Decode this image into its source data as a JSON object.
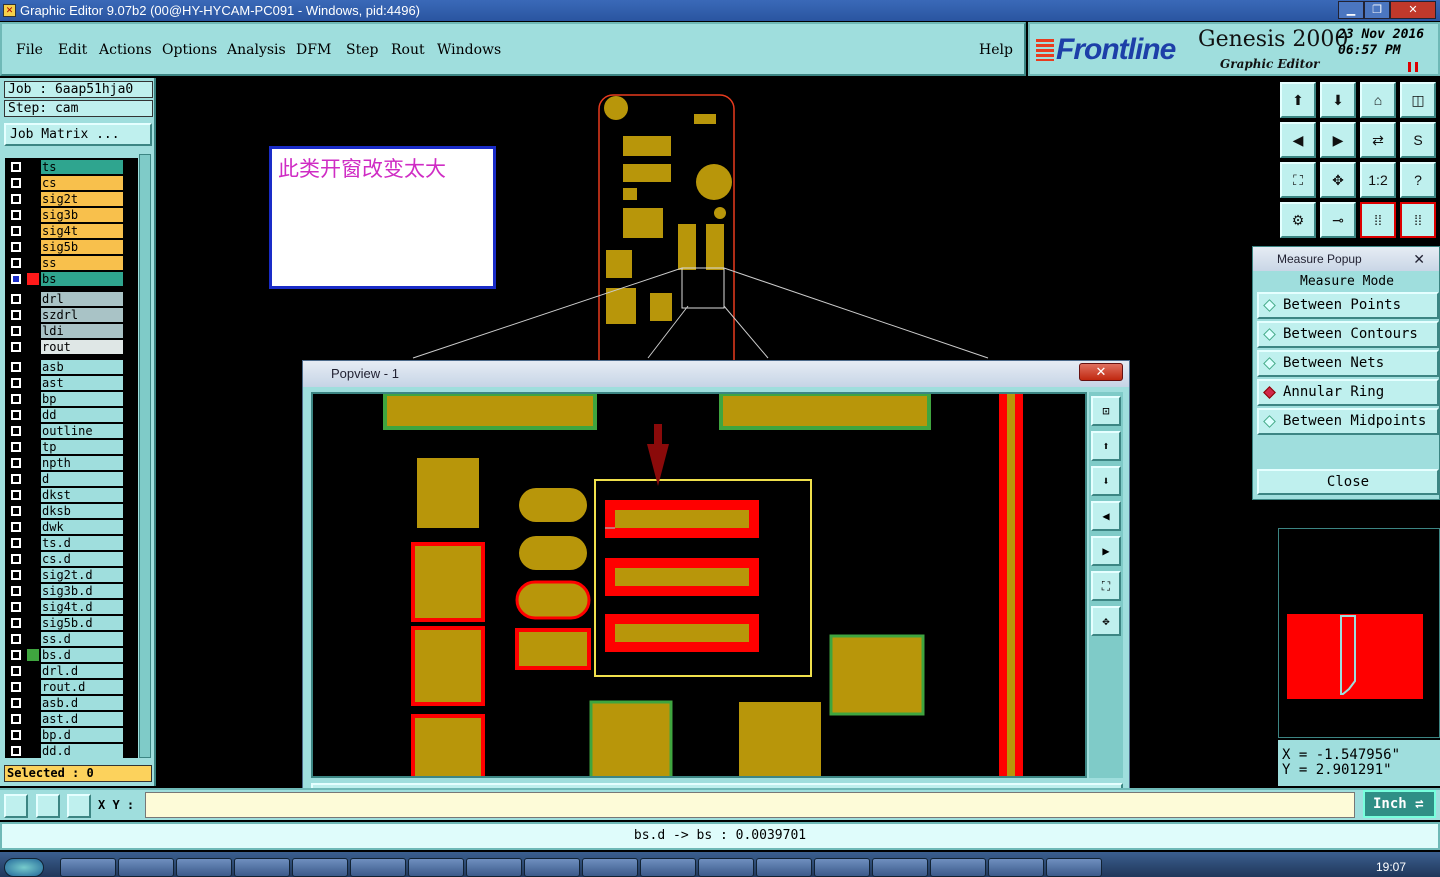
{
  "window": {
    "title": "Graphic Editor 9.07b2 (00@HY-HYCAM-PC091 - Windows, pid:4496)"
  },
  "menu": {
    "items": [
      "File",
      "Edit",
      "Actions",
      "Options",
      "Analysis",
      "DFM",
      "Step",
      "Rout",
      "Windows"
    ],
    "help": "Help"
  },
  "brand": {
    "logo": "Frontline",
    "product": "Genesis 2000",
    "subtitle": "Graphic Editor",
    "date": "23 Nov 2016",
    "time": "06:57 PM"
  },
  "job": {
    "job_line": "Job : 6aap51hja0",
    "step_line": "Step: cam",
    "matrix_button": "Job Matrix ..."
  },
  "layers": [
    {
      "name": "ts",
      "color": "#2fa58f"
    },
    {
      "name": "cs",
      "color": "#f8c04c"
    },
    {
      "name": "sig2t",
      "color": "#f8c04c"
    },
    {
      "name": "sig3b",
      "color": "#f8c04c"
    },
    {
      "name": "sig4t",
      "color": "#f8c04c"
    },
    {
      "name": "sig5b",
      "color": "#f8c04c"
    },
    {
      "name": "ss",
      "color": "#f8c04c"
    },
    {
      "name": "bs",
      "color": "#2fa58f"
    },
    {
      "name": "drl",
      "color": "#a9c3c6"
    },
    {
      "name": "szdrl",
      "color": "#a9c3c6"
    },
    {
      "name": "ldi",
      "color": "#a9c3c6"
    },
    {
      "name": "rout",
      "color": "#dfe7e6"
    },
    {
      "name": "asb",
      "color": "#9fdedd"
    },
    {
      "name": "ast",
      "color": "#9fdedd"
    },
    {
      "name": "bp",
      "color": "#9fdedd"
    },
    {
      "name": "dd",
      "color": "#9fdedd"
    },
    {
      "name": "outline",
      "color": "#9fdedd"
    },
    {
      "name": "tp",
      "color": "#9fdedd"
    },
    {
      "name": "npth",
      "color": "#9fdedd"
    },
    {
      "name": "d",
      "color": "#9fdedd"
    },
    {
      "name": "dkst",
      "color": "#9fdedd"
    },
    {
      "name": "dksb",
      "color": "#9fdedd"
    },
    {
      "name": "dwk",
      "color": "#9fdedd"
    },
    {
      "name": "ts.d",
      "color": "#9fdedd"
    },
    {
      "name": "cs.d",
      "color": "#9fdedd"
    },
    {
      "name": "sig2t.d",
      "color": "#9fdedd"
    },
    {
      "name": "sig3b.d",
      "color": "#9fdedd"
    },
    {
      "name": "sig4t.d",
      "color": "#9fdedd"
    },
    {
      "name": "sig5b.d",
      "color": "#9fdedd"
    },
    {
      "name": "ss.d",
      "color": "#9fdedd"
    },
    {
      "name": "bs.d",
      "color": "#9fdedd"
    },
    {
      "name": "drl.d",
      "color": "#9fdedd"
    },
    {
      "name": "rout.d",
      "color": "#9fdedd"
    },
    {
      "name": "asb.d",
      "color": "#9fdedd"
    },
    {
      "name": "ast.d",
      "color": "#9fdedd"
    },
    {
      "name": "bp.d",
      "color": "#9fdedd"
    },
    {
      "name": "dd.d",
      "color": "#9fdedd"
    }
  ],
  "selected": "Selected : 0",
  "xy_label": "X Y :",
  "units_button": "Inch",
  "status": "bs.d -> bs : 0.0039701",
  "note": "此类开窗改变太大",
  "popview": {
    "title": "Popview - 1",
    "close": "Close"
  },
  "measure": {
    "title": "Measure Popup",
    "mode_label": "Measure Mode",
    "options": [
      "Between Points",
      "Between Contours",
      "Between Nets",
      "Annular Ring",
      "Between Midpoints"
    ],
    "selected": "Annular Ring",
    "close": "Close"
  },
  "coords": {
    "x": "X = -1.547956\"",
    "y": "Y = 2.901291\""
  },
  "clock": "19:07",
  "colors": {
    "panel": "#9fdedd",
    "copper": "#b8960a",
    "mask": "#ff0000",
    "outline": "#e83b1e"
  }
}
